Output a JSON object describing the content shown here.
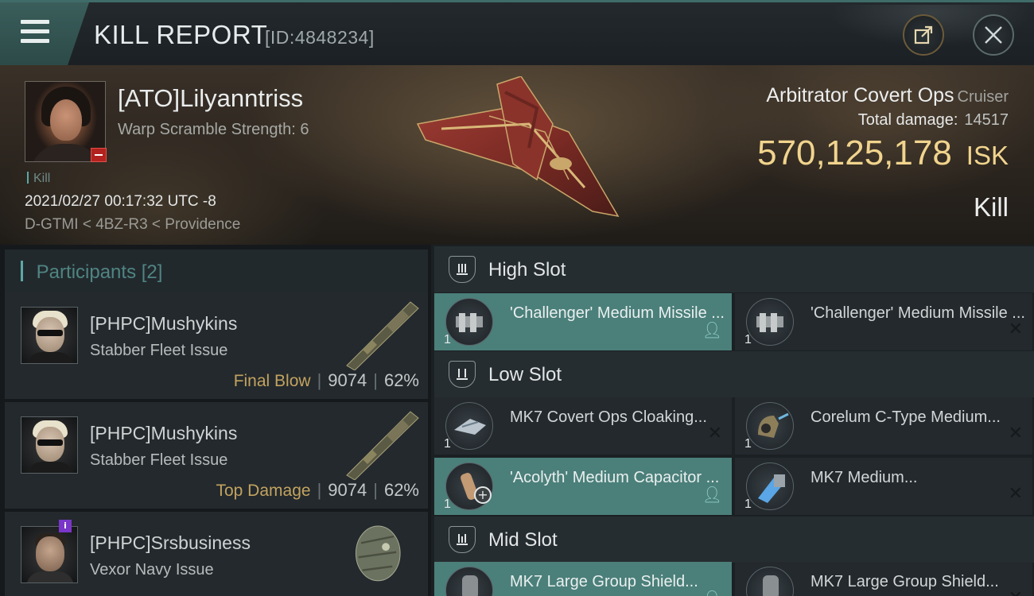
{
  "header": {
    "title": "KILL REPORT",
    "report_id": "[ID:4848234]",
    "menu_icon": "hamburger-icon",
    "share_icon": "share-icon",
    "close_icon": "close-icon"
  },
  "victim": {
    "name": "[ATO]Lilyanntriss",
    "warp_scramble": "Warp Scramble Strength: 6",
    "kill_tag": "Kill",
    "datetime": "2021/02/27 00:17:32 UTC -8",
    "location": "D-GTMI < 4BZ-R3 < Providence"
  },
  "ship": {
    "name": "Arbitrator Covert Ops",
    "class": "Cruiser",
    "total_damage_label": "Total damage:",
    "total_damage": "14517",
    "isk_value": "570,125,178",
    "isk_unit": "ISK",
    "result": "Kill"
  },
  "participants": {
    "title": "Participants",
    "count": "[2]",
    "items": [
      {
        "name": "[PHPC]Mushykins",
        "ship": "Stabber Fleet Issue",
        "tag": "Final Blow",
        "damage": "9074",
        "percent": "62%"
      },
      {
        "name": "[PHPC]Mushykins",
        "ship": "Stabber Fleet Issue",
        "tag": "Top Damage",
        "damage": "9074",
        "percent": "62%"
      },
      {
        "name": "[PHPC]Srsbusiness",
        "ship": "Vexor Navy Issue",
        "tag": "",
        "damage": "",
        "percent": ""
      }
    ],
    "sep": "|"
  },
  "fitting": {
    "high_slot": {
      "title": "High Slot",
      "modules": [
        {
          "name": "'Challenger' Medium Missile ...",
          "qty": "1",
          "status": "person"
        },
        {
          "name": "'Challenger' Medium Missile ...",
          "qty": "1",
          "status": "x"
        }
      ]
    },
    "low_slot": {
      "title": "Low Slot",
      "modules": [
        {
          "name": "MK7 Covert Ops Cloaking...",
          "qty": "1",
          "status": "x"
        },
        {
          "name": "Corelum C-Type Medium...",
          "qty": "1",
          "status": "x"
        },
        {
          "name": "'Acolyth' Medium Capacitor ...",
          "qty": "1",
          "status": "person"
        },
        {
          "name": "MK7 Medium...",
          "qty": "1",
          "status": "x"
        }
      ]
    },
    "mid_slot": {
      "title": "Mid Slot",
      "modules": [
        {
          "name": "MK7 Large Group Shield...",
          "qty": "1",
          "status": "person"
        },
        {
          "name": "MK7 Large Group Shield...",
          "qty": "1",
          "status": "x"
        }
      ]
    }
  },
  "colors": {
    "accent_teal": "#4b7f7a",
    "isk_gold": "#f1d48d",
    "tag_gold": "#c3a35f",
    "badge_red": "#b2221e",
    "badge_purple": "#7a36c8"
  }
}
